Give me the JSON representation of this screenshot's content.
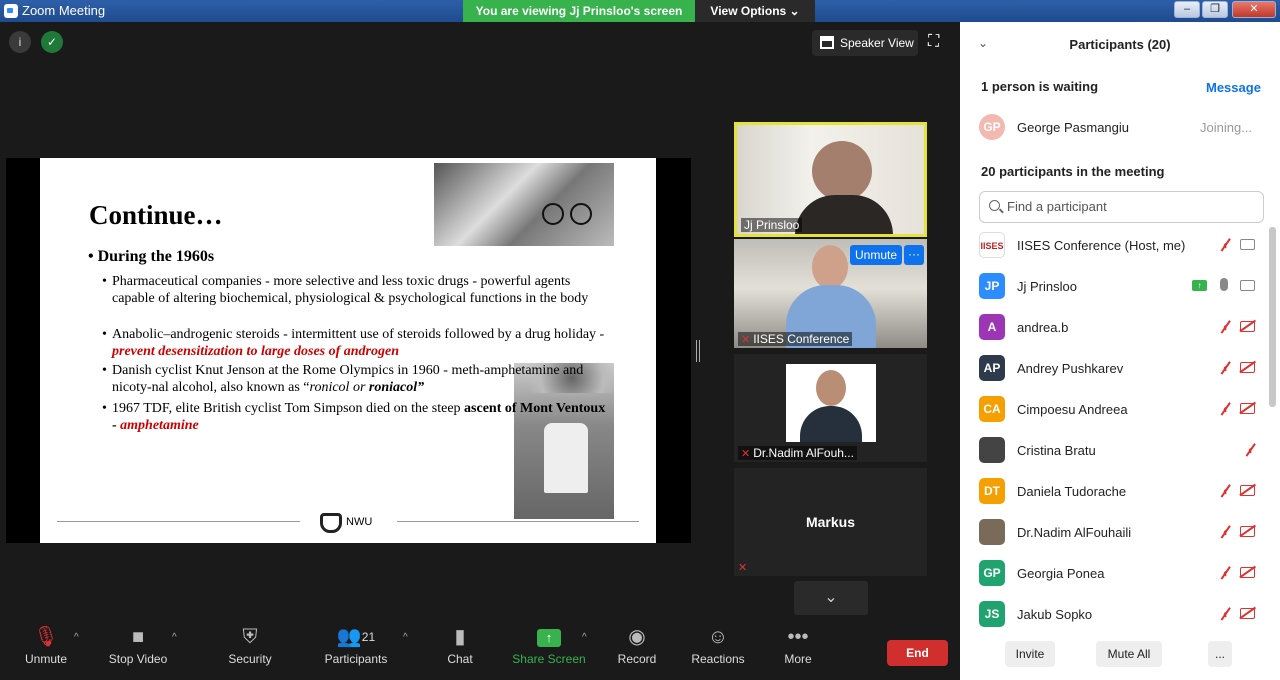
{
  "window": {
    "title": "Zoom Meeting",
    "viewing_banner": "You are viewing Jj Prinsloo's screen",
    "view_options": "View Options ⌄"
  },
  "top": {
    "speaker_view": "Speaker View"
  },
  "slide": {
    "title": "Continue…",
    "heading": "• During the 1960s",
    "b1": "Pharmaceutical companies - more selective and less toxic drugs - powerful agents capable of altering biochemical, physiological & psychological functions in the body",
    "b2_text": "Anabolic–androgenic steroids - intermittent use of steroids followed by a drug holiday - ",
    "b2_red": "prevent desensitization to large doses of androgen",
    "b3_text": "Danish cyclist Knut Jenson at the Rome Olympics in 1960 - meth-amphetamine and nicoty-nal alcohol, also known as “",
    "b3_italic": "ronicol or ",
    "b3_bold": "roniacol”",
    "b4_text": "1967 TDF, elite British cyclist Tom Simpson died on the steep ",
    "b4_bold": "ascent of Mont Ventoux",
    "b4_sep": " - ",
    "b4_red": "amphetamine",
    "logo_text": "NWU"
  },
  "tiles": {
    "jj": "Jj Prinsloo",
    "iises": "IISES Conference",
    "unmute": "Unmute",
    "more": "···",
    "nadim": "Dr.Nadim AlFouh...",
    "markus": "Markus"
  },
  "toolbar": {
    "unmute": "Unmute",
    "stop_video": "Stop Video",
    "security": "Security",
    "participants": "Participants",
    "participants_count": "21",
    "chat": "Chat",
    "share_screen": "Share Screen",
    "record": "Record",
    "reactions": "Reactions",
    "more": "More",
    "end": "End"
  },
  "panel": {
    "title": "Participants (20)",
    "waiting_label": "1 person is waiting",
    "message": "Message",
    "waiting": {
      "initials": "GP",
      "name": "George Pasmangiu",
      "status": "Joining..."
    },
    "in_meeting_label": "20 participants in the meeting",
    "search_placeholder": "Find a participant",
    "participants": [
      {
        "initials": "IISES",
        "name": "IISES Conference (Host, me)",
        "color": "#ffffff"
      },
      {
        "initials": "JP",
        "name": "Jj Prinsloo",
        "color": "#2d8cff"
      },
      {
        "initials": "A",
        "name": "andrea.b",
        "color": "#9c36b5"
      },
      {
        "initials": "AP",
        "name": "Andrey Pushkarev",
        "color": "#2f3b4d"
      },
      {
        "initials": "CA",
        "name": "Cimpoesu Andreea",
        "color": "#f59f00"
      },
      {
        "initials": "",
        "name": "Cristina Bratu",
        "color": "#444444"
      },
      {
        "initials": "DT",
        "name": "Daniela Tudorache",
        "color": "#f59f00"
      },
      {
        "initials": "",
        "name": "Dr.Nadim AlFouhaili",
        "color": "#7a6a5a"
      },
      {
        "initials": "GP",
        "name": "Georgia Ponea",
        "color": "#20a36f"
      },
      {
        "initials": "JS",
        "name": "Jakub Sopko",
        "color": "#20a36f"
      }
    ],
    "invite": "Invite",
    "mute_all": "Mute All",
    "more": "..."
  }
}
